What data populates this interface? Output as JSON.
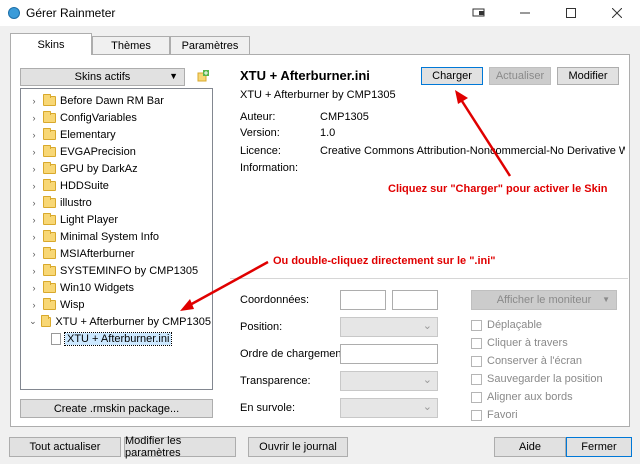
{
  "window": {
    "title": "Gérer Rainmeter"
  },
  "tabs": [
    {
      "label": "Skins"
    },
    {
      "label": "Thèmes"
    },
    {
      "label": "Paramètres"
    }
  ],
  "skins": {
    "dropdown_label": "Skins actifs",
    "tree": [
      {
        "label": "Before Dawn RM Bar"
      },
      {
        "label": "ConfigVariables"
      },
      {
        "label": "Elementary"
      },
      {
        "label": "EVGAPrecision"
      },
      {
        "label": "GPU by DarkAz"
      },
      {
        "label": "HDDSuite"
      },
      {
        "label": "illustro"
      },
      {
        "label": "Light Player"
      },
      {
        "label": "Minimal System Info"
      },
      {
        "label": "MSIAfterburner"
      },
      {
        "label": "SYSTEMINFO by CMP1305"
      },
      {
        "label": "Win10 Widgets"
      },
      {
        "label": "Wisp"
      },
      {
        "label": "XTU + Afterburner by CMP1305"
      },
      {
        "label": "XTU + Afterburner.ini"
      }
    ],
    "create_package_label": "Create .rmskin package..."
  },
  "details": {
    "skin_file": "XTU + Afterburner.ini",
    "skin_name": "XTU + Afterburner by CMP1305",
    "load_label": "Charger",
    "refresh_label": "Actualiser",
    "edit_label": "Modifier",
    "author_label": "Auteur:",
    "author_value": "CMP1305",
    "version_label": "Version:",
    "version_value": "1.0",
    "license_label": "Licence:",
    "license_value": "Creative Commons Attribution-Noncommercial-No Derivative Wor...",
    "info_label": "Information:"
  },
  "settings": {
    "coordinates_label": "Coordonnées:",
    "position_label": "Position:",
    "load_order_label": "Ordre de chargement:",
    "transparency_label": "Transparence:",
    "hover_label": "En survole:",
    "monitor_label": "Afficher le moniteur",
    "checkboxes": [
      {
        "label": "Déplaçable"
      },
      {
        "label": "Cliquer à travers"
      },
      {
        "label": "Conserver à l'écran"
      },
      {
        "label": "Sauvegarder la position"
      },
      {
        "label": "Aligner aux bords"
      },
      {
        "label": "Favori"
      }
    ]
  },
  "annotations": {
    "load_hint": "Cliquez sur \"Charger\" pour activer le Skin",
    "dblclick_hint": "Ou double-cliquez directement sur le \".ini\"",
    "color": "#e00000"
  },
  "footer": {
    "refresh_all_label": "Tout actualiser",
    "edit_settings_label": "Modifier les paramètres",
    "open_log_label": "Ouvrir le journal",
    "help_label": "Aide",
    "close_label": "Fermer"
  }
}
